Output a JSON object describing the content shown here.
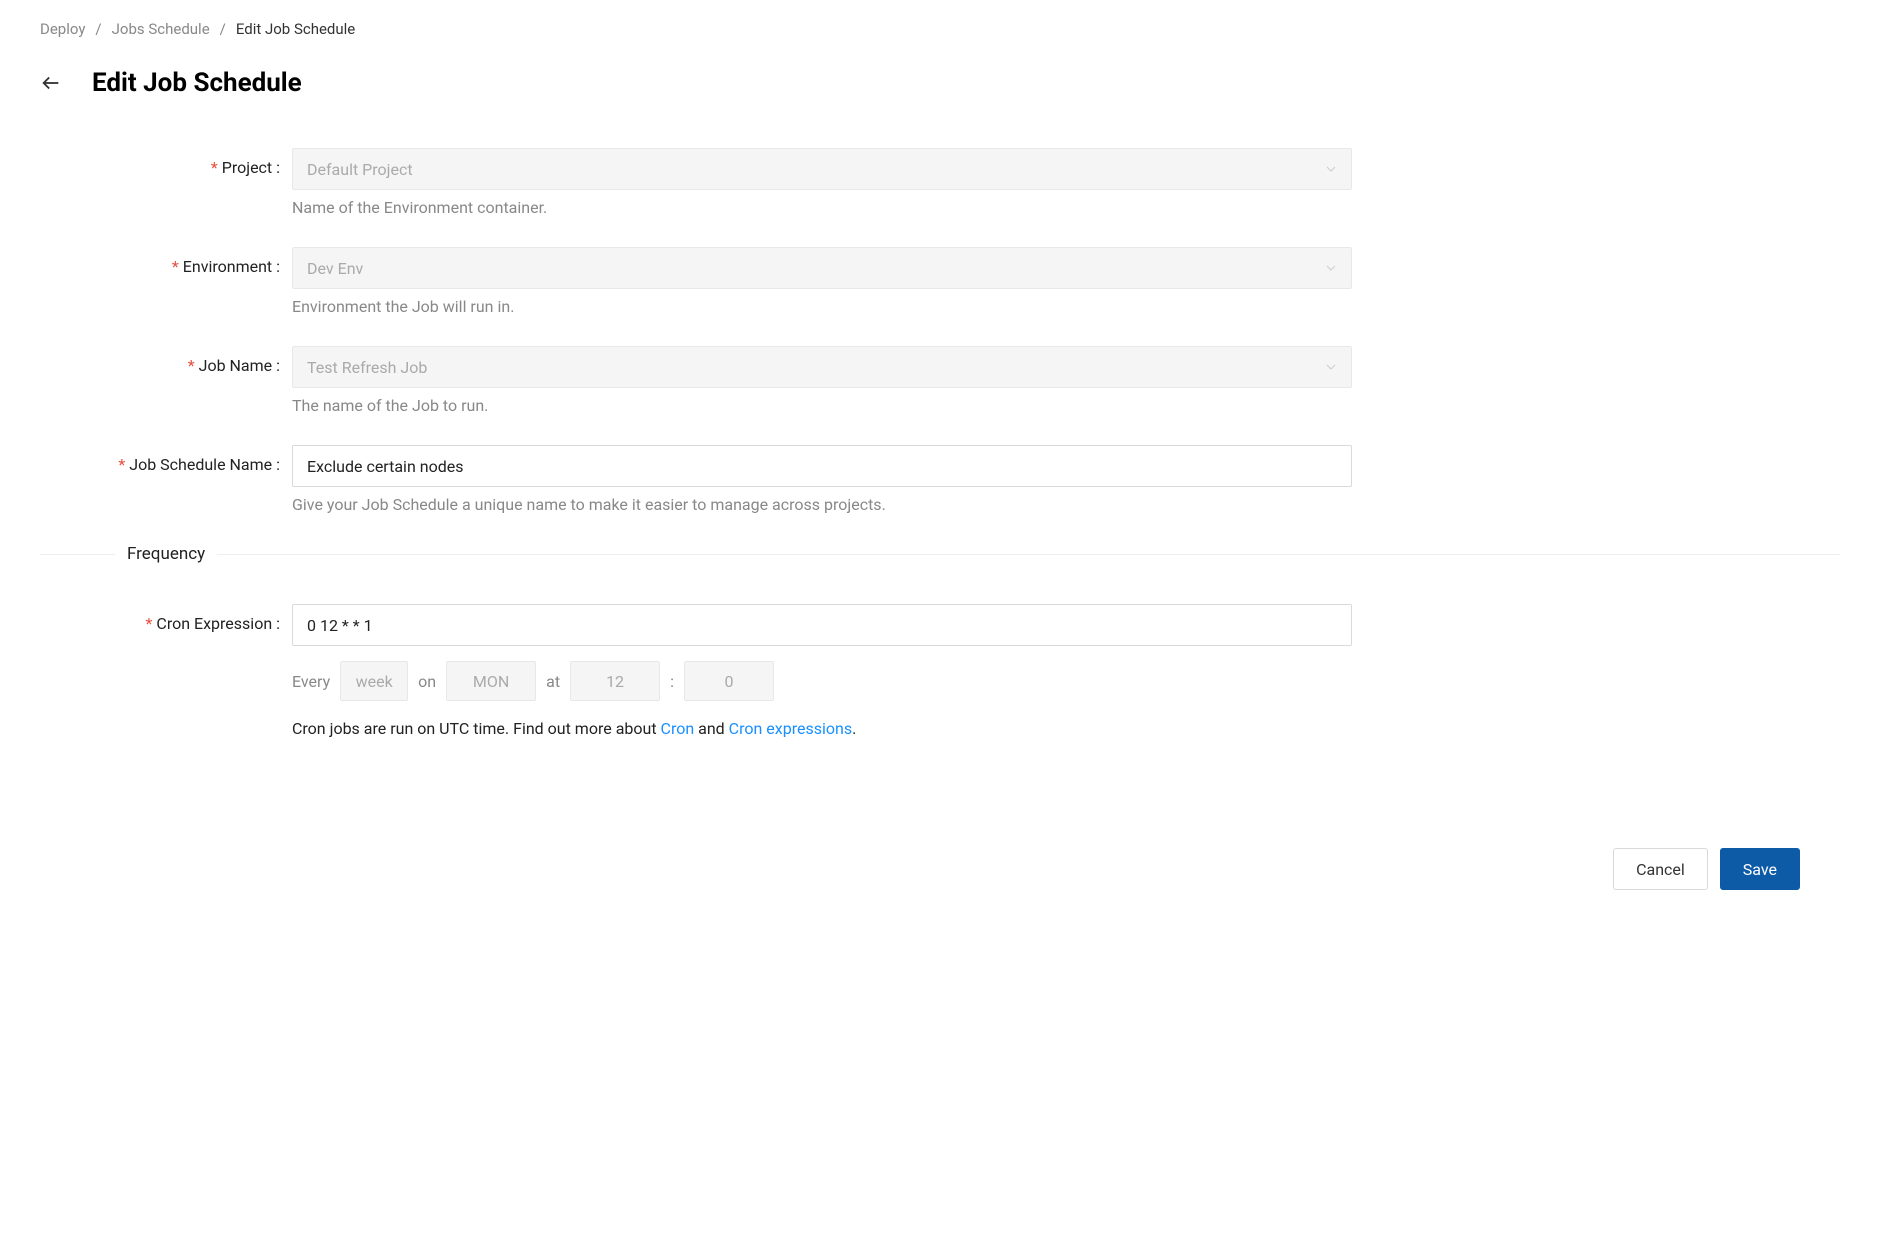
{
  "breadcrumb": {
    "items": [
      "Deploy",
      "Jobs Schedule"
    ],
    "current": "Edit Job Schedule"
  },
  "header": {
    "title": "Edit Job Schedule"
  },
  "form": {
    "project": {
      "label": "Project",
      "value": "Default Project",
      "help": "Name of the Environment container."
    },
    "environment": {
      "label": "Environment",
      "value": "Dev Env",
      "help": "Environment the Job will run in."
    },
    "job_name": {
      "label": "Job Name",
      "value": "Test Refresh Job",
      "help": "The name of the Job to run."
    },
    "schedule_name": {
      "label": "Job Schedule Name",
      "value": "Exclude certain nodes",
      "help": "Give your Job Schedule a unique name to make it easier to manage across projects."
    }
  },
  "frequency": {
    "section_title": "Frequency",
    "cron_label": "Cron Expression",
    "cron_value": "0 12 * * 1",
    "parsed": {
      "every_label": "Every",
      "unit": "week",
      "on_label": "on",
      "day": "MON",
      "at_label": "at",
      "hour": "12",
      "colon": ":",
      "minute": "0"
    },
    "info_prefix": "Cron jobs are run on UTC time. Find out more about ",
    "link1": "Cron",
    "info_and": " and ",
    "link2": "Cron expressions",
    "info_suffix": "."
  },
  "buttons": {
    "cancel": "Cancel",
    "save": "Save"
  }
}
